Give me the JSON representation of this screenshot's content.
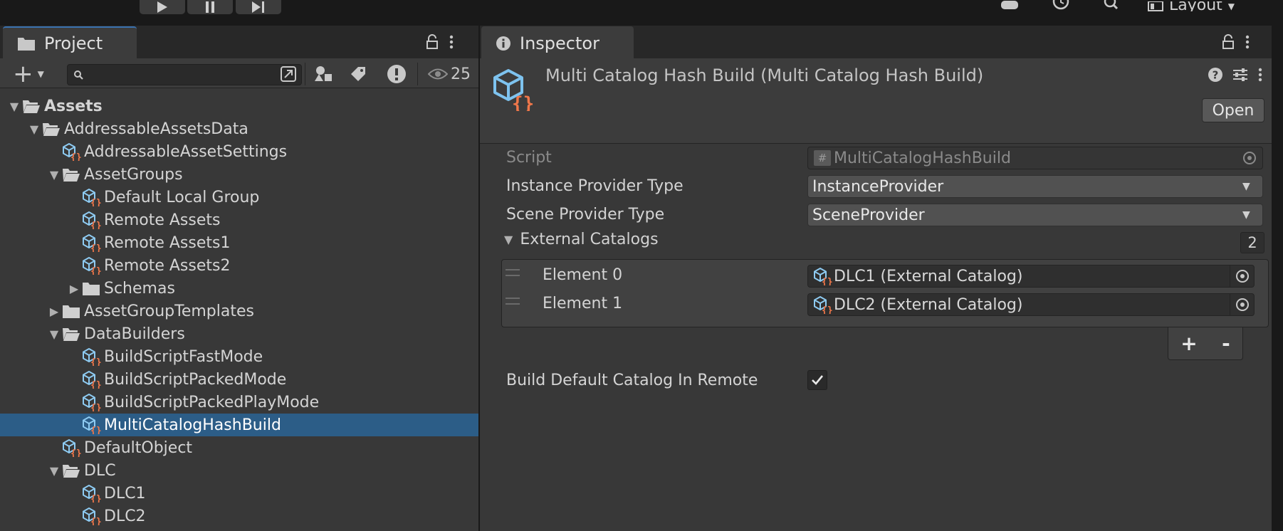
{
  "toolbar": {
    "layout_label": "Layout"
  },
  "project": {
    "tab_label": "Project",
    "search": {
      "value": "",
      "placeholder": ""
    },
    "visible_count": "25",
    "tree": [
      {
        "label": "Assets",
        "depth": 0,
        "arrow": "down",
        "icon": "folder-open",
        "bold": true
      },
      {
        "label": "AddressableAssetsData",
        "depth": 1,
        "arrow": "down",
        "icon": "folder-open"
      },
      {
        "label": "AddressableAssetSettings",
        "depth": 2,
        "arrow": "",
        "icon": "script-object"
      },
      {
        "label": "AssetGroups",
        "depth": 2,
        "arrow": "down",
        "icon": "folder-open"
      },
      {
        "label": "Default Local Group",
        "depth": 3,
        "arrow": "",
        "icon": "script-object"
      },
      {
        "label": "Remote Assets",
        "depth": 3,
        "arrow": "",
        "icon": "script-object"
      },
      {
        "label": "Remote Assets1",
        "depth": 3,
        "arrow": "",
        "icon": "script-object"
      },
      {
        "label": "Remote Assets2",
        "depth": 3,
        "arrow": "",
        "icon": "script-object"
      },
      {
        "label": "Schemas",
        "depth": 3,
        "arrow": "right",
        "icon": "folder"
      },
      {
        "label": "AssetGroupTemplates",
        "depth": 2,
        "arrow": "right",
        "icon": "folder"
      },
      {
        "label": "DataBuilders",
        "depth": 2,
        "arrow": "down",
        "icon": "folder-open"
      },
      {
        "label": "BuildScriptFastMode",
        "depth": 3,
        "arrow": "",
        "icon": "script-object"
      },
      {
        "label": "BuildScriptPackedMode",
        "depth": 3,
        "arrow": "",
        "icon": "script-object"
      },
      {
        "label": "BuildScriptPackedPlayMode",
        "depth": 3,
        "arrow": "",
        "icon": "script-object"
      },
      {
        "label": "MultiCatalogHashBuild",
        "depth": 3,
        "arrow": "",
        "icon": "script-object",
        "selected": true
      },
      {
        "label": "DefaultObject",
        "depth": 2,
        "arrow": "",
        "icon": "script-object"
      },
      {
        "label": "DLC",
        "depth": 2,
        "arrow": "down",
        "icon": "folder-open"
      },
      {
        "label": "DLC1",
        "depth": 3,
        "arrow": "",
        "icon": "script-object"
      },
      {
        "label": "DLC2",
        "depth": 3,
        "arrow": "",
        "icon": "script-object"
      }
    ]
  },
  "inspector": {
    "tab_label": "Inspector",
    "title": "Multi Catalog Hash Build (Multi Catalog Hash Build)",
    "open_button": "Open",
    "script_label": "Script",
    "script_value": "MultiCatalogHashBuild",
    "instance_provider_label": "Instance Provider Type",
    "instance_provider_value": "InstanceProvider",
    "scene_provider_label": "Scene Provider Type",
    "scene_provider_value": "SceneProvider",
    "external_catalogs_label": "External Catalogs",
    "external_catalogs_count": "2",
    "elements": [
      {
        "label": "Element 0",
        "value": "DLC1 (External Catalog)"
      },
      {
        "label": "Element 1",
        "value": "DLC2 (External Catalog)"
      }
    ],
    "add_button": "+",
    "remove_button": "-",
    "build_default_label": "Build Default Catalog In Remote",
    "build_default_checked": true
  },
  "colors": {
    "selection": "#2c5d87",
    "tab_accent": "#3a72b0",
    "icon_cube": "#7ec3ef",
    "icon_braces": "#f0774a"
  }
}
